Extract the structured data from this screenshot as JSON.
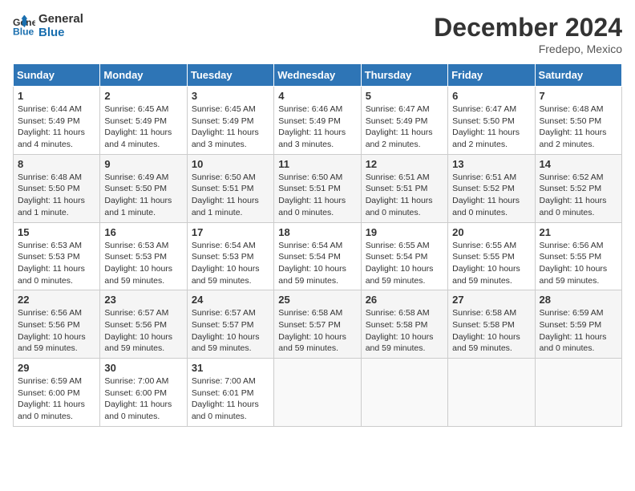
{
  "header": {
    "logo_line1": "General",
    "logo_line2": "Blue",
    "month": "December 2024",
    "location": "Fredepo, Mexico"
  },
  "weekdays": [
    "Sunday",
    "Monday",
    "Tuesday",
    "Wednesday",
    "Thursday",
    "Friday",
    "Saturday"
  ],
  "weeks": [
    [
      {
        "day": "1",
        "lines": [
          "Sunrise: 6:44 AM",
          "Sunset: 5:49 PM",
          "Daylight: 11 hours",
          "and 4 minutes."
        ]
      },
      {
        "day": "2",
        "lines": [
          "Sunrise: 6:45 AM",
          "Sunset: 5:49 PM",
          "Daylight: 11 hours",
          "and 4 minutes."
        ]
      },
      {
        "day": "3",
        "lines": [
          "Sunrise: 6:45 AM",
          "Sunset: 5:49 PM",
          "Daylight: 11 hours",
          "and 3 minutes."
        ]
      },
      {
        "day": "4",
        "lines": [
          "Sunrise: 6:46 AM",
          "Sunset: 5:49 PM",
          "Daylight: 11 hours",
          "and 3 minutes."
        ]
      },
      {
        "day": "5",
        "lines": [
          "Sunrise: 6:47 AM",
          "Sunset: 5:49 PM",
          "Daylight: 11 hours",
          "and 2 minutes."
        ]
      },
      {
        "day": "6",
        "lines": [
          "Sunrise: 6:47 AM",
          "Sunset: 5:50 PM",
          "Daylight: 11 hours",
          "and 2 minutes."
        ]
      },
      {
        "day": "7",
        "lines": [
          "Sunrise: 6:48 AM",
          "Sunset: 5:50 PM",
          "Daylight: 11 hours",
          "and 2 minutes."
        ]
      }
    ],
    [
      {
        "day": "8",
        "lines": [
          "Sunrise: 6:48 AM",
          "Sunset: 5:50 PM",
          "Daylight: 11 hours",
          "and 1 minute."
        ]
      },
      {
        "day": "9",
        "lines": [
          "Sunrise: 6:49 AM",
          "Sunset: 5:50 PM",
          "Daylight: 11 hours",
          "and 1 minute."
        ]
      },
      {
        "day": "10",
        "lines": [
          "Sunrise: 6:50 AM",
          "Sunset: 5:51 PM",
          "Daylight: 11 hours",
          "and 1 minute."
        ]
      },
      {
        "day": "11",
        "lines": [
          "Sunrise: 6:50 AM",
          "Sunset: 5:51 PM",
          "Daylight: 11 hours",
          "and 0 minutes."
        ]
      },
      {
        "day": "12",
        "lines": [
          "Sunrise: 6:51 AM",
          "Sunset: 5:51 PM",
          "Daylight: 11 hours",
          "and 0 minutes."
        ]
      },
      {
        "day": "13",
        "lines": [
          "Sunrise: 6:51 AM",
          "Sunset: 5:52 PM",
          "Daylight: 11 hours",
          "and 0 minutes."
        ]
      },
      {
        "day": "14",
        "lines": [
          "Sunrise: 6:52 AM",
          "Sunset: 5:52 PM",
          "Daylight: 11 hours",
          "and 0 minutes."
        ]
      }
    ],
    [
      {
        "day": "15",
        "lines": [
          "Sunrise: 6:53 AM",
          "Sunset: 5:53 PM",
          "Daylight: 11 hours",
          "and 0 minutes."
        ]
      },
      {
        "day": "16",
        "lines": [
          "Sunrise: 6:53 AM",
          "Sunset: 5:53 PM",
          "Daylight: 10 hours",
          "and 59 minutes."
        ]
      },
      {
        "day": "17",
        "lines": [
          "Sunrise: 6:54 AM",
          "Sunset: 5:53 PM",
          "Daylight: 10 hours",
          "and 59 minutes."
        ]
      },
      {
        "day": "18",
        "lines": [
          "Sunrise: 6:54 AM",
          "Sunset: 5:54 PM",
          "Daylight: 10 hours",
          "and 59 minutes."
        ]
      },
      {
        "day": "19",
        "lines": [
          "Sunrise: 6:55 AM",
          "Sunset: 5:54 PM",
          "Daylight: 10 hours",
          "and 59 minutes."
        ]
      },
      {
        "day": "20",
        "lines": [
          "Sunrise: 6:55 AM",
          "Sunset: 5:55 PM",
          "Daylight: 10 hours",
          "and 59 minutes."
        ]
      },
      {
        "day": "21",
        "lines": [
          "Sunrise: 6:56 AM",
          "Sunset: 5:55 PM",
          "Daylight: 10 hours",
          "and 59 minutes."
        ]
      }
    ],
    [
      {
        "day": "22",
        "lines": [
          "Sunrise: 6:56 AM",
          "Sunset: 5:56 PM",
          "Daylight: 10 hours",
          "and 59 minutes."
        ]
      },
      {
        "day": "23",
        "lines": [
          "Sunrise: 6:57 AM",
          "Sunset: 5:56 PM",
          "Daylight: 10 hours",
          "and 59 minutes."
        ]
      },
      {
        "day": "24",
        "lines": [
          "Sunrise: 6:57 AM",
          "Sunset: 5:57 PM",
          "Daylight: 10 hours",
          "and 59 minutes."
        ]
      },
      {
        "day": "25",
        "lines": [
          "Sunrise: 6:58 AM",
          "Sunset: 5:57 PM",
          "Daylight: 10 hours",
          "and 59 minutes."
        ]
      },
      {
        "day": "26",
        "lines": [
          "Sunrise: 6:58 AM",
          "Sunset: 5:58 PM",
          "Daylight: 10 hours",
          "and 59 minutes."
        ]
      },
      {
        "day": "27",
        "lines": [
          "Sunrise: 6:58 AM",
          "Sunset: 5:58 PM",
          "Daylight: 10 hours",
          "and 59 minutes."
        ]
      },
      {
        "day": "28",
        "lines": [
          "Sunrise: 6:59 AM",
          "Sunset: 5:59 PM",
          "Daylight: 11 hours",
          "and 0 minutes."
        ]
      }
    ],
    [
      {
        "day": "29",
        "lines": [
          "Sunrise: 6:59 AM",
          "Sunset: 6:00 PM",
          "Daylight: 11 hours",
          "and 0 minutes."
        ]
      },
      {
        "day": "30",
        "lines": [
          "Sunrise: 7:00 AM",
          "Sunset: 6:00 PM",
          "Daylight: 11 hours",
          "and 0 minutes."
        ]
      },
      {
        "day": "31",
        "lines": [
          "Sunrise: 7:00 AM",
          "Sunset: 6:01 PM",
          "Daylight: 11 hours",
          "and 0 minutes."
        ]
      },
      null,
      null,
      null,
      null
    ]
  ]
}
